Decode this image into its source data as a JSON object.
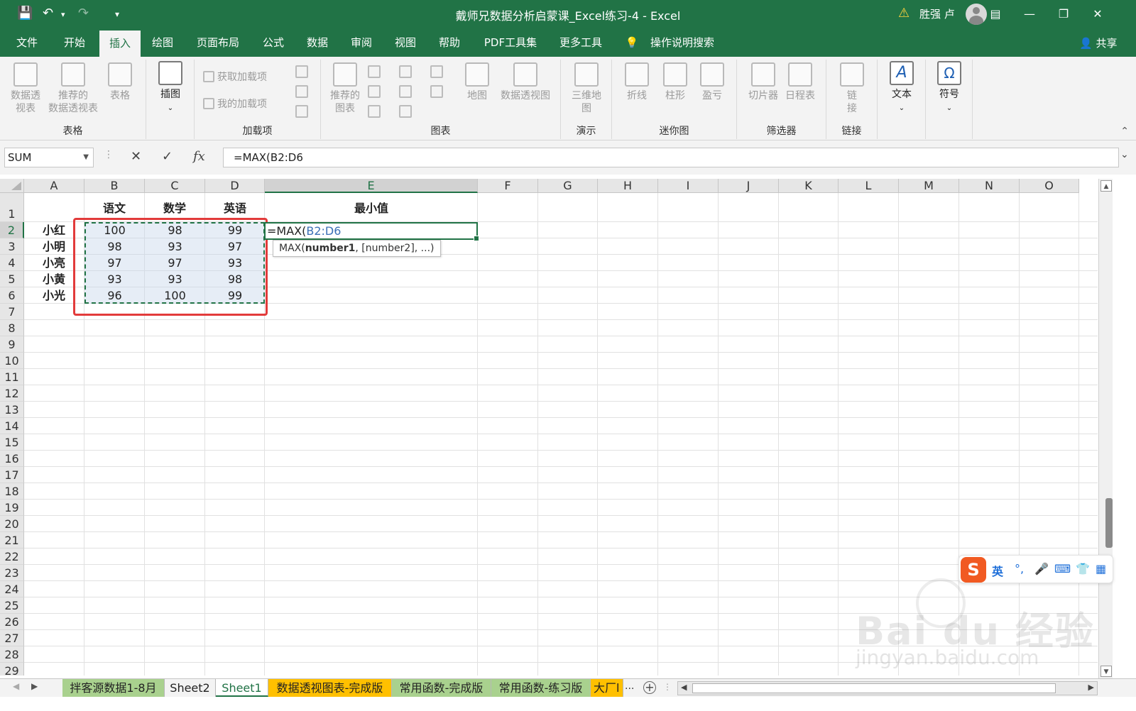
{
  "window": {
    "title": "戴师兄数据分析启蒙课_Excel练习-4  -  Excel",
    "user_name": "胜强 卢"
  },
  "menu_tabs": [
    {
      "label": "文件"
    },
    {
      "label": "开始"
    },
    {
      "label": "插入"
    },
    {
      "label": "绘图"
    },
    {
      "label": "页面布局"
    },
    {
      "label": "公式"
    },
    {
      "label": "数据"
    },
    {
      "label": "审阅"
    },
    {
      "label": "视图"
    },
    {
      "label": "帮助"
    },
    {
      "label": "PDF工具集"
    },
    {
      "label": "更多工具"
    },
    {
      "label": "操作说明搜索"
    }
  ],
  "share_label": "共享",
  "ribbon": {
    "tables": {
      "label": "表格",
      "pivot": "数据透\n视表",
      "recommended": "推荐的\n数据透视表",
      "table": "表格"
    },
    "illustrations": {
      "insert_image": "插图"
    },
    "addins": {
      "label": "加载项",
      "get": "获取加载项",
      "mine": "我的加载项"
    },
    "charts": {
      "label": "图表",
      "recommended": "推荐的\n图表",
      "map": "地图",
      "pivot_chart": "数据透视图"
    },
    "tours": {
      "label": "演示",
      "3d_map": "三维地\n图"
    },
    "sparklines": {
      "label": "迷你图",
      "line": "折线",
      "column": "柱形",
      "win_loss": "盈亏"
    },
    "filters": {
      "label": "筛选器",
      "slicer": "切片器",
      "timeline": "日程表"
    },
    "links": {
      "label": "链接",
      "link": "链\n接"
    },
    "text": {
      "label": "文本"
    },
    "symbols": {
      "label": "符号"
    }
  },
  "formula_bar": {
    "name_box": "SUM",
    "formula": "=MAX(B2:D6"
  },
  "columns": [
    "A",
    "B",
    "C",
    "D",
    "E",
    "F",
    "G",
    "H",
    "I",
    "J",
    "K",
    "L",
    "M",
    "N",
    "O"
  ],
  "rows": [
    "1",
    "2",
    "3",
    "4",
    "5",
    "6",
    "7",
    "8",
    "9",
    "10",
    "11",
    "12",
    "13",
    "14",
    "15",
    "16",
    "17",
    "18",
    "19",
    "20",
    "21",
    "22",
    "23",
    "24",
    "25",
    "26",
    "27",
    "28",
    "29"
  ],
  "table": {
    "headers": [
      "语文",
      "数学",
      "英语",
      "最小值"
    ],
    "names": [
      "小红",
      "小明",
      "小亮",
      "小黄",
      "小光"
    ],
    "scores": [
      [
        "100",
        "98",
        "99"
      ],
      [
        "98",
        "93",
        "97"
      ],
      [
        "97",
        "97",
        "93"
      ],
      [
        "93",
        "93",
        "98"
      ],
      [
        "96",
        "100",
        "99"
      ]
    ]
  },
  "editing": {
    "prefix": "=MAX(",
    "ref": "B2:D6",
    "tooltip_fn": "MAX(",
    "tooltip_arg1": "number1",
    "tooltip_rest": ", [number2], ...)"
  },
  "sheet_tabs": [
    {
      "label": "拌客源数据1-8月"
    },
    {
      "label": "Sheet2"
    },
    {
      "label": "Sheet1"
    },
    {
      "label": "数据透视图表-完成版"
    },
    {
      "label": "常用函数-完成版"
    },
    {
      "label": "常用函数-练习版"
    },
    {
      "label": "大厂l"
    }
  ],
  "sheet_more": "...",
  "ime": {
    "mode": "英",
    "punct": "°,"
  },
  "watermark": {
    "logo": "Bai du 经验",
    "url": "jingyan.baidu.com"
  },
  "colors": {
    "excel_green": "#217346",
    "selection_red": "#e23b3b",
    "tab_orange": "#ffc000",
    "tab_green": "#a9d18e"
  }
}
